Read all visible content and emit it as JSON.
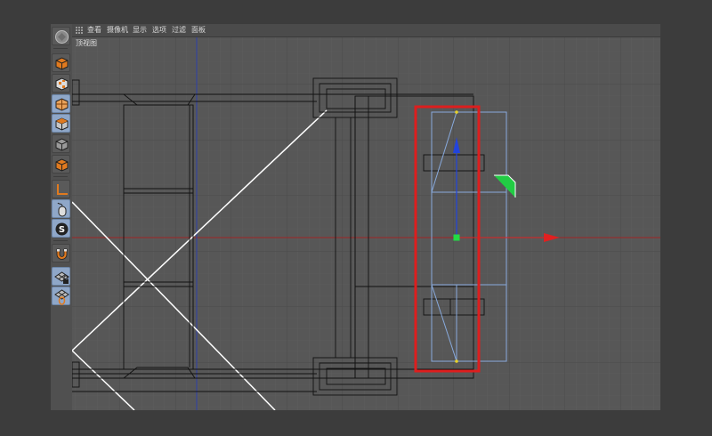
{
  "menu": {
    "view": "查看",
    "camera": "摄像机",
    "display": "显示",
    "options": "选项",
    "filter": "过滤",
    "panel": "面板"
  },
  "viewport": {
    "name": "顶视图"
  },
  "toolbar": {
    "icons": [
      "app-logo-icon",
      "cube-mode-icon",
      "checker-cube-icon",
      "texture-cube-icon",
      "model-mode-icon",
      "object-mode-icon",
      "edit-mode-icon",
      "axis-icon",
      "mouse-tweak-icon",
      "snap-icon",
      "magnet-icon",
      "workplane-lock-icon",
      "workplane-icon"
    ],
    "selected": [
      "texture-cube-icon",
      "edit-mode-icon",
      "mouse-tweak-icon",
      "snap-icon",
      "workplane-lock-icon",
      "workplane-icon"
    ]
  },
  "colors": {
    "highlight_box": "#dd1e1e",
    "axis_x": "#e02020",
    "axis_y": "#2244dd",
    "axis_z": "#00bb33",
    "selection": "#88aadd",
    "wire": "#000000",
    "guide_lines": "#ffffff",
    "grid_minor": "#5e5e5e",
    "grid_major": "#4a4a4a"
  }
}
